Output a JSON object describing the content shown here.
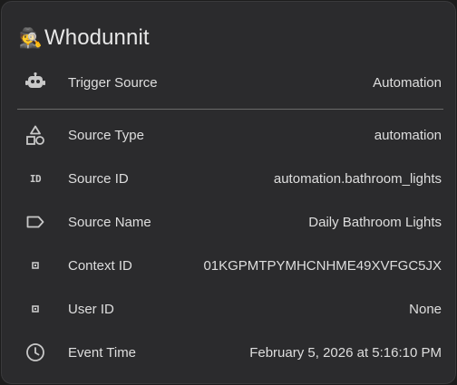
{
  "card": {
    "title": "Whodunnit",
    "title_emoji": "🕵️",
    "title_emoji_name": "detective-icon"
  },
  "rows": [
    {
      "label": "Trigger Source",
      "value": "Automation",
      "icon": "robot-icon"
    },
    {
      "label": "Source Type",
      "value": "automation",
      "icon": "shapes-icon"
    },
    {
      "label": "Source ID",
      "value": "automation.bathroom_lights",
      "icon": "id-icon",
      "icon_text": "ID"
    },
    {
      "label": "Source Name",
      "value": "Daily Bathroom Lights",
      "icon": "label-tag-icon"
    },
    {
      "label": "Context ID",
      "value": "01KGPMTPYMHCNHME49XVFGC5JX",
      "icon": "small-square-icon"
    },
    {
      "label": "User ID",
      "value": "None",
      "icon": "small-square-icon"
    },
    {
      "label": "Event Time",
      "value": "February 5, 2026 at 5:16:10 PM",
      "icon": "clock-icon"
    }
  ],
  "colors": {
    "background": "#1c1c1c",
    "card": "#2b2b2d",
    "text": "#e3e3e3",
    "icon": "#c8c8c8",
    "divider": "#6a6a6a"
  }
}
